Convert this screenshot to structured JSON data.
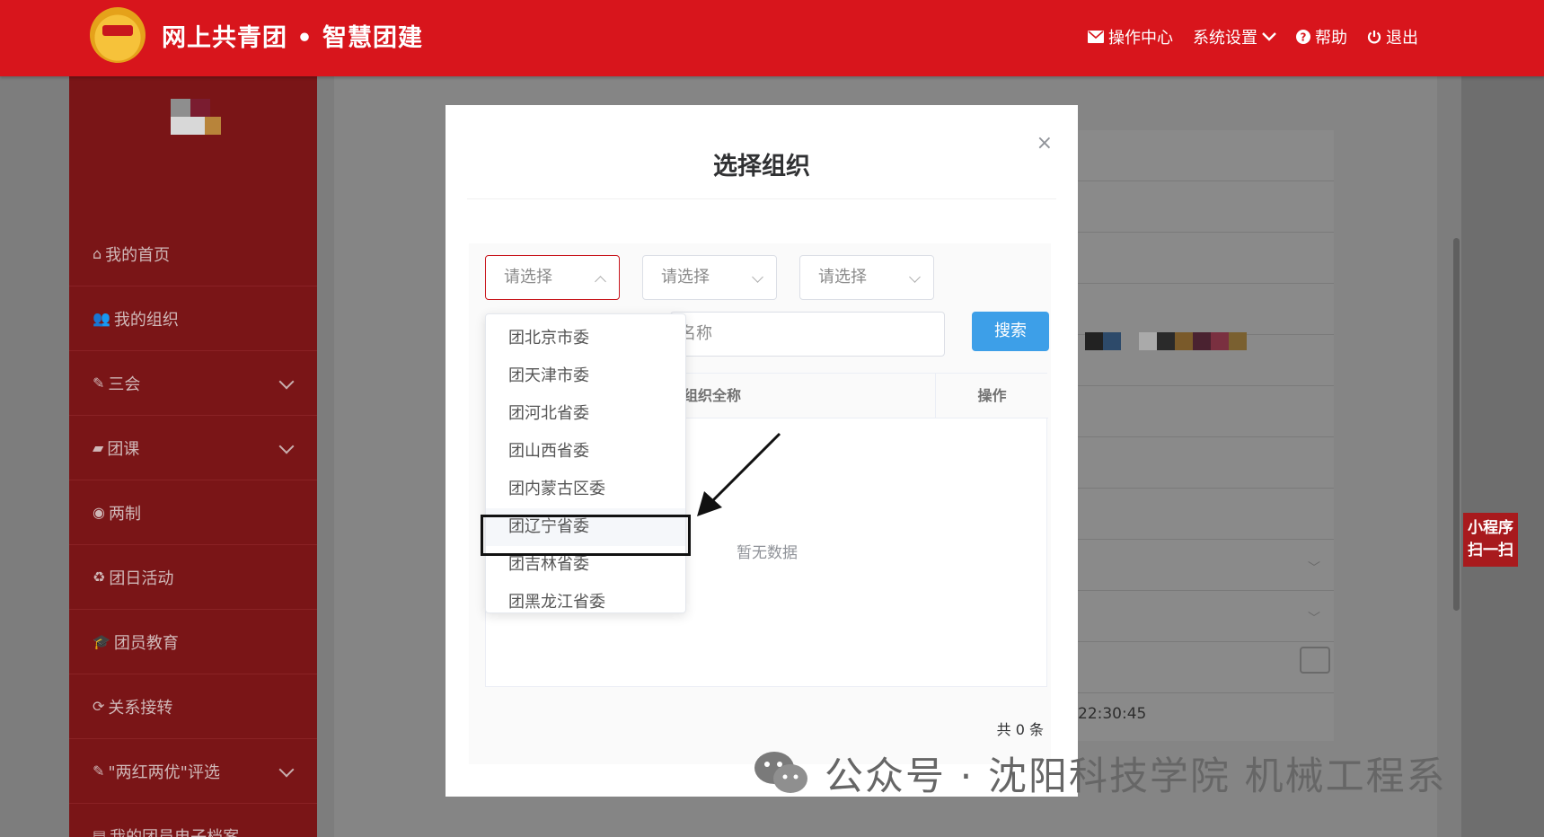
{
  "header": {
    "brand": "网上共青团 • 智慧团建",
    "nav": [
      {
        "icon": "mail-icon",
        "label": "操作中心"
      },
      {
        "icon": "settings-icon",
        "label": "系统设置"
      },
      {
        "icon": "help-icon",
        "label": "帮助"
      },
      {
        "icon": "power-icon",
        "label": "退出"
      }
    ]
  },
  "sidebar": {
    "items": [
      {
        "icon": "home-icon",
        "label": "我的首页",
        "expandable": false
      },
      {
        "icon": "users-icon",
        "label": "我的组织",
        "expandable": false
      },
      {
        "icon": "edit-icon",
        "label": "三会",
        "expandable": true
      },
      {
        "icon": "folder-icon",
        "label": "团课",
        "expandable": true
      },
      {
        "icon": "target-icon",
        "label": "两制",
        "expandable": false
      },
      {
        "icon": "recycle-icon",
        "label": "团日活动",
        "expandable": false
      },
      {
        "icon": "graduation-cap-icon",
        "label": "团员教育",
        "expandable": false
      },
      {
        "icon": "refresh-icon",
        "label": "关系接转",
        "expandable": false
      },
      {
        "icon": "edit-icon",
        "label": "\"两红两优\"评选",
        "expandable": true
      },
      {
        "icon": "file-icon",
        "label": "我的团员电子档案",
        "expandable": false
      }
    ]
  },
  "background": {
    "timestamp": "22:30:45",
    "mini_program": {
      "line1": "小程序",
      "line2": "扫一扫"
    }
  },
  "modal": {
    "title": "选择组织",
    "close": "×",
    "selects": [
      {
        "placeholder": "请选择",
        "open": true
      },
      {
        "placeholder": "请选择",
        "open": false
      },
      {
        "placeholder": "请选择",
        "open": false
      }
    ],
    "name_placeholder": "名称",
    "search_label": "搜索",
    "table": {
      "columns": [
        "组织全称",
        "操作"
      ],
      "empty_text": "暂无数据"
    },
    "total": "共 0 条",
    "dropdown_options": [
      "团北京市委",
      "团天津市委",
      "团河北省委",
      "团山西省委",
      "团内蒙古区委",
      "团辽宁省委",
      "团吉林省委",
      "团黑龙江省委"
    ],
    "highlighted_option": "团辽宁省委"
  },
  "watermark": "公众号 · 沈阳科技学院 机械工程系",
  "colors": {
    "brand_red": "#d8151c",
    "button_blue": "#3d9fe8",
    "sidebar_dimmed": "#7a1517"
  }
}
